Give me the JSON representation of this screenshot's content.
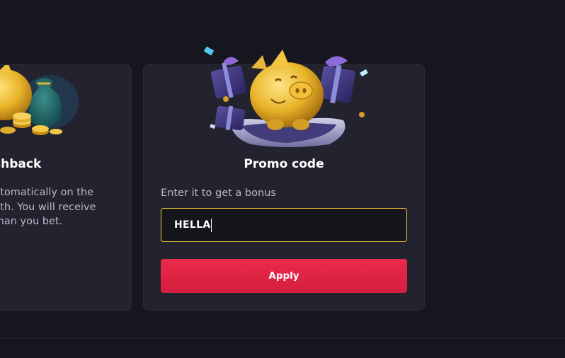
{
  "cashback_card": {
    "title": "shback",
    "description_lines": [
      "utomatically on the",
      "nth. You will receive",
      "than you bet."
    ]
  },
  "promo_card": {
    "title": "Promo code",
    "hint": "Enter it to get a bonus",
    "input_value": "HELLA",
    "apply_label": "Apply"
  },
  "colors": {
    "accent_yellow": "#e8c435",
    "apply_red": "#e02445",
    "background": "#16161e",
    "card": "#23232f"
  },
  "icons": {
    "promo_illustration": "piggy-bank-with-gifts-icon",
    "cashback_illustration": "piggy-bank-with-coins-icon"
  }
}
